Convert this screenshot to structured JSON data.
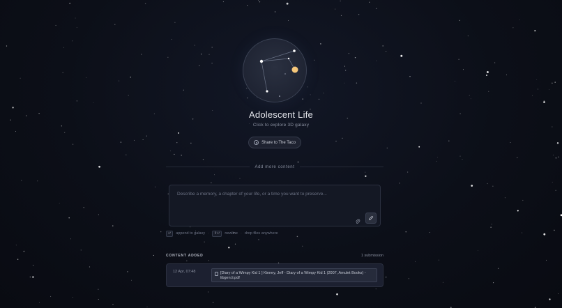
{
  "galaxy": {
    "title": "Adolescent Life",
    "subtitle": "Click to explore 3D galaxy",
    "share_label": "Share to The Taco"
  },
  "composer": {
    "section_label": "Add more content",
    "placeholder": "Describe a memory, a chapter of your life, or a time you want to preserve...",
    "value": ""
  },
  "hints": {
    "enter_key": "↵",
    "append_label": "append to galaxy",
    "shift_enter_key": "⇧↵",
    "newline_label": "newline",
    "drop_label": "drop files anywhere"
  },
  "content": {
    "header": "CONTENT ADDED",
    "count_label": "1 submission",
    "entries": [
      {
        "date": "12 Apr, 07:48",
        "file_line1": "[Diary of a Wimpy Kid 1 ] Kinney, Jeff - Diary of a Wimpy Kid 1 (2007, Amulet Books) -",
        "file_line2": "libgen.li.pdf"
      }
    ]
  },
  "icons": {
    "share": "share-icon",
    "attach": "paperclip-icon",
    "submit": "pencil-icon",
    "file": "file-icon"
  },
  "colors": {
    "background": "#0c0f18",
    "star_highlight": "#f5c77a",
    "card": "#1c2030"
  }
}
